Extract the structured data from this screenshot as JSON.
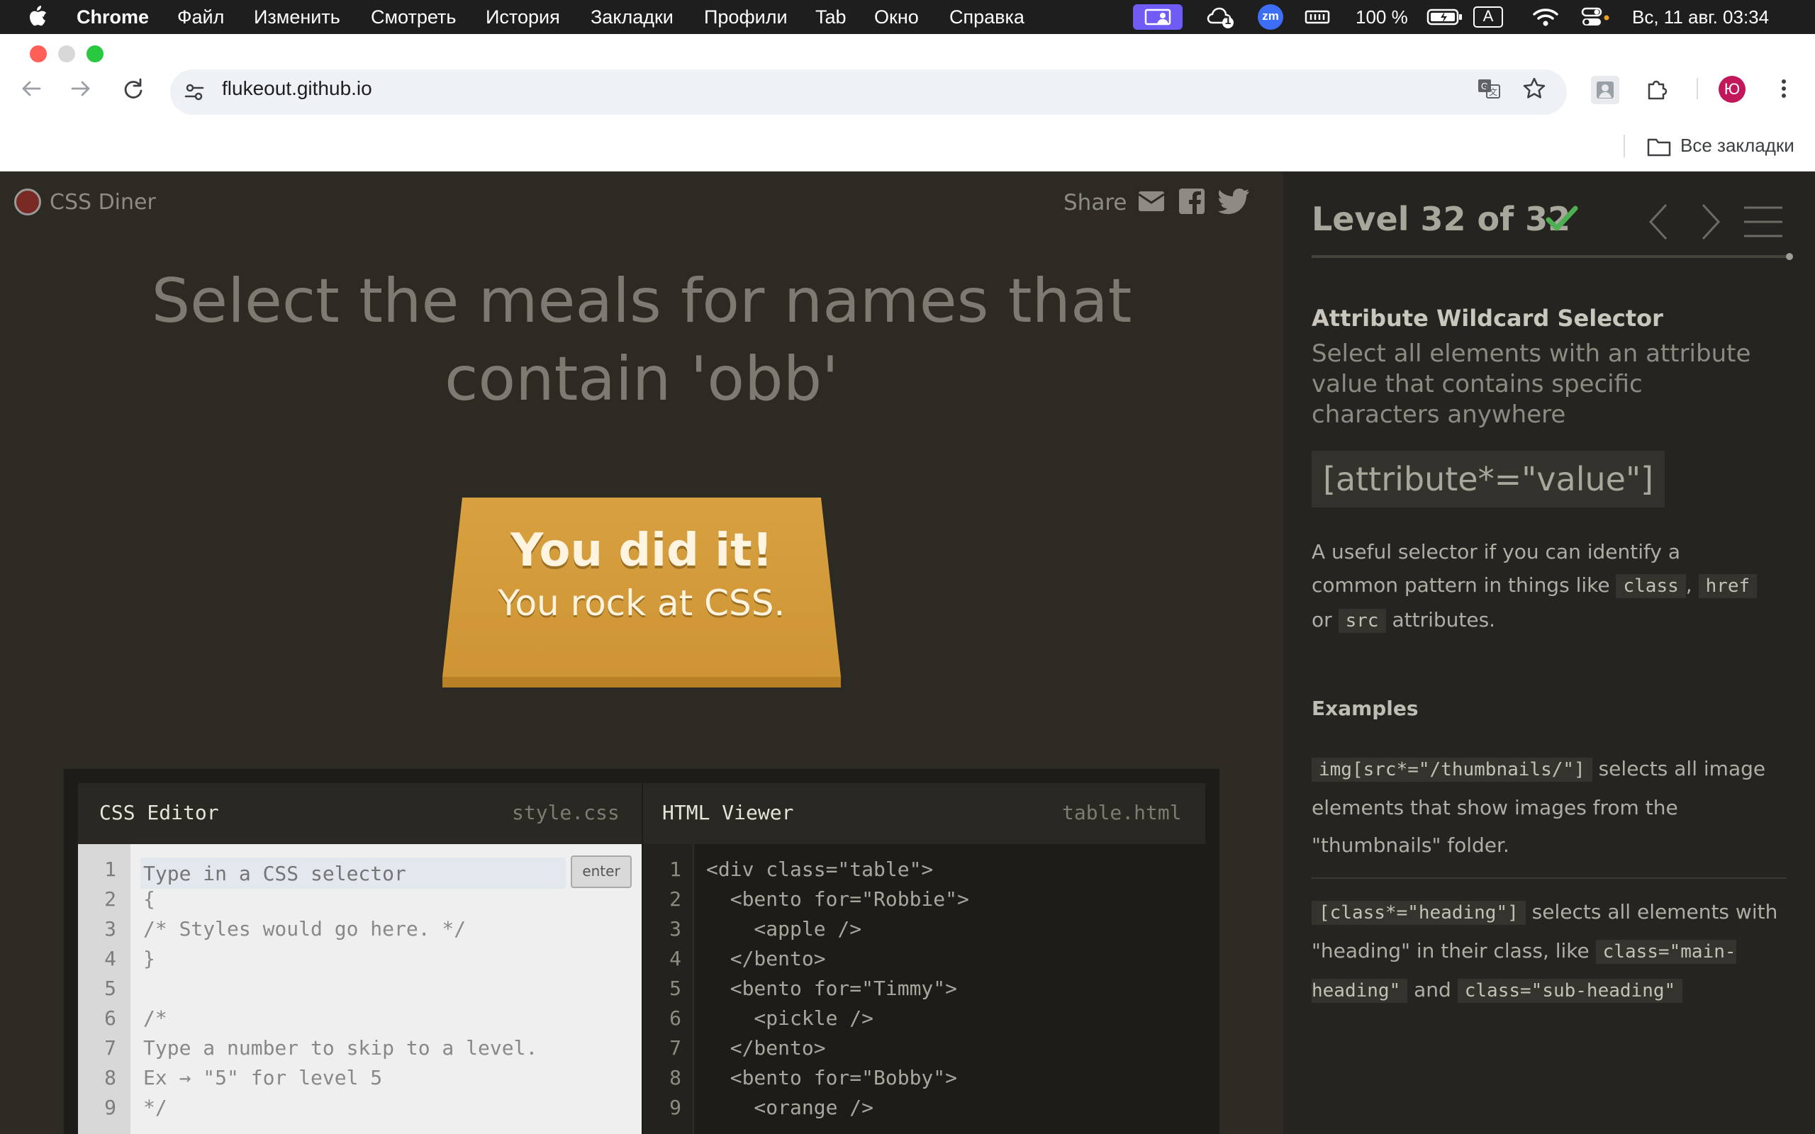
{
  "menubar": {
    "app_name": "Chrome",
    "items": [
      "Файл",
      "Изменить",
      "Смотреть",
      "История",
      "Закладки",
      "Профили",
      "Tab",
      "Окно",
      "Справка"
    ],
    "status": {
      "notif_badge": "1",
      "zoom_label": "zm",
      "battery": "100 %",
      "input_source": "A",
      "datetime": "Вс, 11 авг.  03:34"
    }
  },
  "browser": {
    "url": "flukeout.github.io",
    "profile_initial": "Ю",
    "bookmarks_label": "Все закладки"
  },
  "game": {
    "logo_text": "CSS Diner",
    "share_label": "Share",
    "order": "Select the meals for names that contain 'obb'",
    "win_title": "You did it!",
    "win_subtitle": "You rock at CSS.",
    "css_editor": {
      "title": "CSS Editor",
      "file": "style.css",
      "placeholder": "Type in a CSS selector",
      "enter_label": "enter",
      "line_numbers": [
        "1",
        "2",
        "3",
        "4",
        "5",
        "6",
        "7",
        "8",
        "9"
      ],
      "lines": [
        "",
        "{",
        "/* Styles would go here. */",
        "}",
        "",
        "/*",
        "Type a number to skip to a level.",
        "Ex → \"5\" for level 5",
        "*/"
      ]
    },
    "html_viewer": {
      "title": "HTML Viewer",
      "file": "table.html",
      "line_numbers": [
        "1",
        "2",
        "3",
        "4",
        "5",
        "6",
        "7",
        "8",
        "9"
      ],
      "lines": [
        "<div class=\"table\">",
        "  <bento for=\"Robbie\">",
        "    <apple />",
        "  </bento>",
        "  <bento for=\"Timmy\">",
        "    <pickle />",
        "  </bento>",
        "  <bento for=\"Bobby\">",
        "    <orange />"
      ]
    }
  },
  "sidebar": {
    "level_text": "Level 32 of 32",
    "completed": true,
    "progress": 1.0,
    "level_title": "Attribute Wildcard Selector",
    "description": "Select all elements with an attribute value that contains specific characters anywhere",
    "syntax": "[attribute*=\"value\"]",
    "hint": {
      "before": "A useful selector if you can identify a common pattern in things like",
      "code1": "class",
      "sep1": ",",
      "code2": "href",
      "sep2": "or",
      "code3": "src",
      "after": "attributes."
    },
    "examples_title": "Examples",
    "example1": {
      "code": "img[src*=\"/thumbnails/\"]",
      "text": "selects all image elements that show images from the \"thumbnails\" folder."
    },
    "example2": {
      "code": "[class*=\"heading\"]",
      "text1": "selects all elements with \"heading\" in their class, like",
      "code2": "class=\"main-heading\"",
      "and": "and",
      "code3": "class=\"sub-heading\""
    }
  },
  "colors": {
    "accent_green": "#4caf50",
    "table_wood": "#d49a3a",
    "page_bg": "#2c2a23",
    "sidebar_bg": "#252420"
  }
}
